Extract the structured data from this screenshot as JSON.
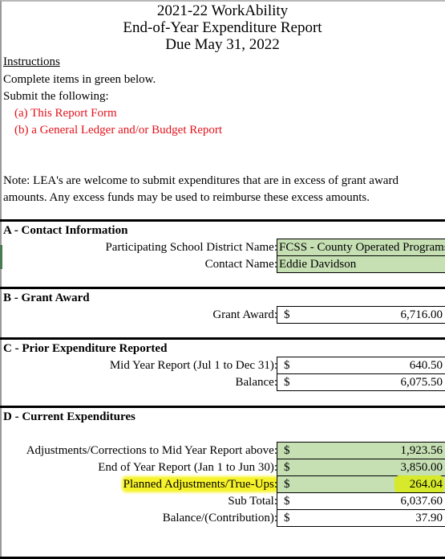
{
  "header": {
    "title_line1": "2021-22 WorkAbility",
    "title_line2": "End-of-Year Expenditure Report",
    "title_line3": "Due May 31, 2022"
  },
  "instructions": {
    "heading": "Instructions",
    "line1": "Complete items in green below.",
    "line2": "Submit the following:",
    "item_a": "(a) This Report Form",
    "item_b": "(b) a General Ledger and/or Budget Report"
  },
  "note": {
    "line1": "Note: LEA's are welcome to submit expenditures that are in excess of grant award",
    "line2": "amounts. Any excess funds may be used to reimburse these excess amounts."
  },
  "section_a": {
    "heading": "A - Contact Information",
    "district_label": "Participating School District Name:",
    "district_value": "FCSS - County Operated Programs",
    "contact_label": "Contact Name:",
    "contact_value": "Eddie Davidson"
  },
  "section_b": {
    "heading": "B - Grant Award",
    "grant_label": "Grant Award:",
    "currency": "$",
    "grant_value": "6,716.00"
  },
  "section_c": {
    "heading": "C - Prior Expenditure Reported",
    "midyear_label": "Mid Year Report (Jul 1 to Dec 31):",
    "midyear_value": "640.50",
    "balance_label": "Balance:",
    "balance_value": "6,075.50",
    "currency": "$"
  },
  "section_d": {
    "heading": "D - Current Expenditures",
    "currency": "$",
    "rows": [
      {
        "label": "Adjustments/Corrections to Mid Year Report above:",
        "value": "1,923.56"
      },
      {
        "label": "End of Year Report (Jan 1 to Jun 30):",
        "value": "3,850.00"
      },
      {
        "label": "Planned Adjustments/True-Ups:",
        "value": "264.04"
      },
      {
        "label": "Sub Total:",
        "value": "6,037.60"
      },
      {
        "label": "Balance/(Contribution):",
        "value": "37.90"
      }
    ]
  },
  "colors": {
    "input_green": "#c6e0b4",
    "instruction_red": "#e2121b",
    "highlight_yellow": "#f7f32a"
  }
}
